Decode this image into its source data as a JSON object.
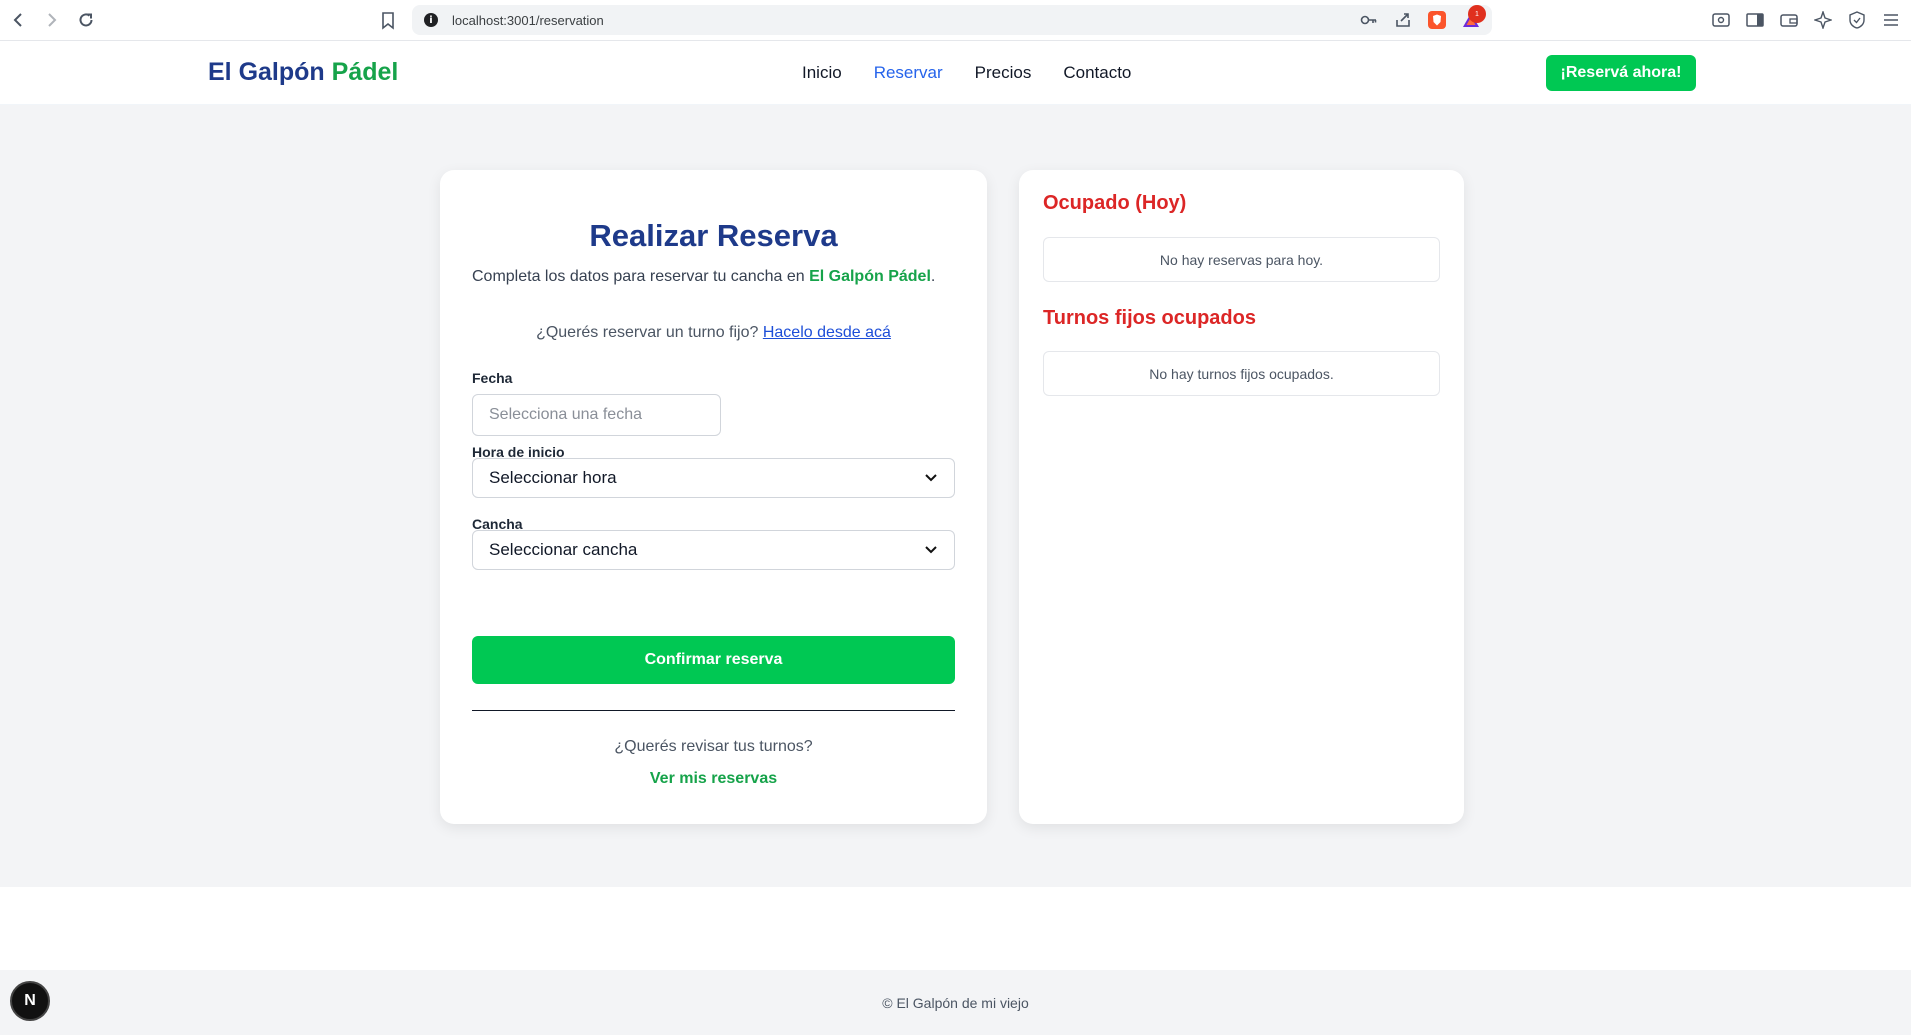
{
  "browser": {
    "url": "localhost:3001/reservation",
    "rewards_badge": "1"
  },
  "header": {
    "logo_part1": "El Galpón",
    "logo_part2": "Pádel",
    "nav": [
      {
        "label": "Inicio"
      },
      {
        "label": "Reservar"
      },
      {
        "label": "Precios"
      },
      {
        "label": "Contacto"
      }
    ],
    "cta_label": "¡Reservá ahora!"
  },
  "form": {
    "title": "Realizar Reserva",
    "subtitle_prefix": "Completa los datos para reservar tu cancha en ",
    "subtitle_brand": "El Galpón Pádel",
    "subtitle_suffix": ".",
    "fixed_question": "¿Querés reservar un turno fijo?",
    "fixed_link": "Hacelo desde acá",
    "date_label": "Fecha",
    "date_placeholder": "Selecciona una fecha",
    "time_label": "Hora de inicio",
    "time_value": "Seleccionar hora",
    "court_label": "Cancha",
    "court_value": "Seleccionar cancha",
    "confirm_label": "Confirmar reserva",
    "review_question": "¿Querés revisar tus turnos?",
    "review_link": "Ver mis reservas"
  },
  "sidebar": {
    "busy_today_title": "Ocupado (Hoy)",
    "busy_today_empty": "No hay reservas para hoy.",
    "fixed_title": "Turnos fijos ocupados",
    "fixed_empty": "No hay turnos fijos ocupados."
  },
  "footer": {
    "text": "© El Galpón de mi viejo"
  },
  "dev_badge": "N",
  "colors": {
    "brand_blue": "#1e3a8a",
    "brand_green": "#16a34a",
    "cta_green": "#00c853",
    "danger_red": "#dc2626",
    "link_blue": "#2563eb"
  }
}
